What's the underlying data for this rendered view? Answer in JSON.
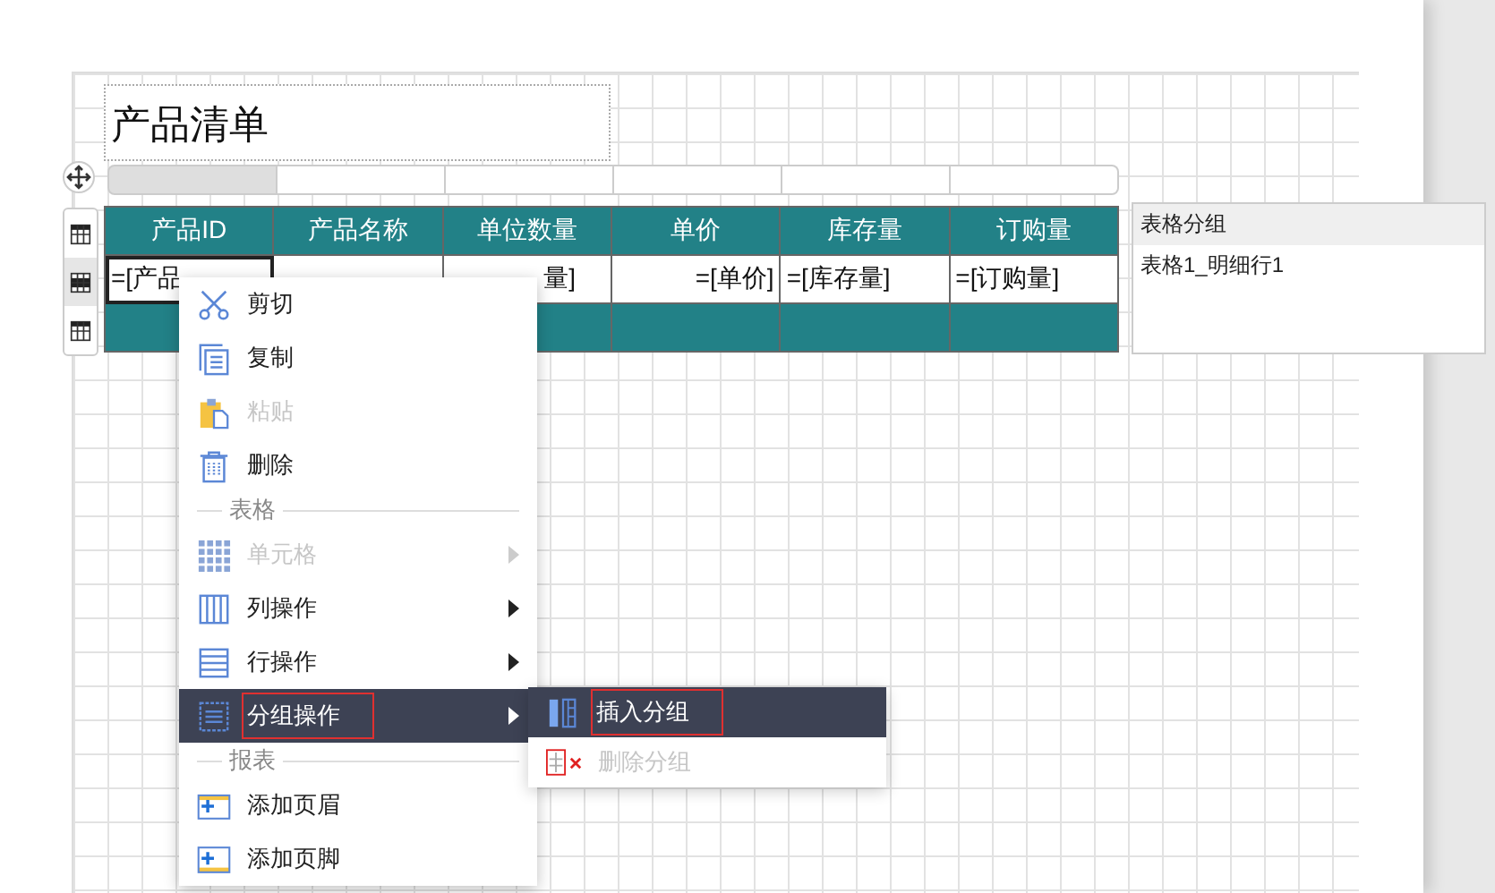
{
  "title": "产品清单",
  "column_handles": [
    {
      "selected": true
    },
    {
      "selected": false
    },
    {
      "selected": false
    },
    {
      "selected": false
    },
    {
      "selected": false
    },
    {
      "selected": false
    }
  ],
  "row_handles": [
    {
      "selected": false
    },
    {
      "selected": true
    },
    {
      "selected": false
    }
  ],
  "table": {
    "columns": [
      "产品ID",
      "产品名称",
      "单位数量",
      "单价",
      "库存量",
      "订购量"
    ],
    "cells": [
      {
        "text": "=[产品",
        "selected": true
      },
      {
        "selected": false
      },
      {
        "text": "量]",
        "selected": false
      },
      {
        "text": "=[单价]",
        "selected": false
      },
      {
        "text": "=[库存量]",
        "selected": false
      },
      {
        "text": "=[订购量]",
        "selected": false
      }
    ]
  },
  "group_panel": {
    "title": "表格分组",
    "items": [
      "表格1_明细行1"
    ]
  },
  "context_menu": {
    "items": [
      {
        "kind": "item",
        "label": "剪切",
        "disabled": false,
        "submenu": false,
        "selected": false
      },
      {
        "kind": "item",
        "label": "复制",
        "disabled": false,
        "submenu": false,
        "selected": false
      },
      {
        "kind": "item",
        "label": "粘贴",
        "disabled": true,
        "submenu": false,
        "selected": false
      },
      {
        "kind": "item",
        "label": "删除",
        "disabled": false,
        "submenu": false,
        "selected": false
      },
      {
        "kind": "section",
        "label": "表格"
      },
      {
        "kind": "item",
        "label": "单元格",
        "disabled": true,
        "submenu": true,
        "selected": false
      },
      {
        "kind": "item",
        "label": "列操作",
        "disabled": false,
        "submenu": true,
        "selected": false
      },
      {
        "kind": "item",
        "label": "行操作",
        "disabled": false,
        "submenu": true,
        "selected": false
      },
      {
        "kind": "item",
        "label": "分组操作",
        "disabled": false,
        "submenu": true,
        "selected": true
      },
      {
        "kind": "section",
        "label": "报表"
      },
      {
        "kind": "item",
        "label": "添加页眉",
        "disabled": false,
        "submenu": false,
        "selected": false
      },
      {
        "kind": "item",
        "label": "添加页脚",
        "disabled": false,
        "submenu": false,
        "selected": false
      }
    ]
  },
  "submenu": {
    "items": [
      {
        "label": "插入分组",
        "disabled": false,
        "selected": true
      },
      {
        "label": "删除分组",
        "disabled": true,
        "selected": false
      }
    ]
  }
}
